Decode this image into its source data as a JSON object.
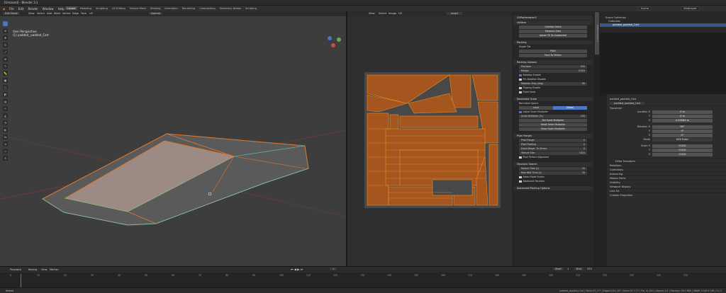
{
  "app": {
    "title": "[Unsaved] - Blender 3.1"
  },
  "menu": [
    "File",
    "Edit",
    "Render",
    "Window",
    "Help"
  ],
  "workspace_tabs": [
    "Layout",
    "Modeling",
    "Sculpting",
    "UV Editing",
    "Texture Paint",
    "Shading",
    "Animation",
    "Rendering",
    "Compositing",
    "Geometry Nodes",
    "Scripting"
  ],
  "active_tab": "Layout",
  "scene": {
    "name": "Scene",
    "view_layer": "ViewLayer"
  },
  "viewport": {
    "mode": "Edit Mode",
    "header_items": [
      "View",
      "Select",
      "Add",
      "Mesh",
      "Vertex",
      "Edge",
      "Face",
      "UV"
    ],
    "orientation": "Normal",
    "info1": "User Perspective",
    "info2": "(1) padded_ padded_Cart"
  },
  "uv_editor": {
    "header_items": [
      "View",
      "Select",
      "Image",
      "UV"
    ],
    "image": "map1"
  },
  "uvpackmaster": {
    "tab": "UVPackmaster3",
    "sections": {
      "utilities": "Utilities",
      "packing": "Packing",
      "packing_options": "Packing Options",
      "normalize_scale": "Normalize Scale",
      "pixel_margin": "Pixel Margin",
      "heuristic": "Heuristic Search",
      "advanced": "Advanced Packing Options"
    },
    "utility_buttons": [
      "Overlap Check",
      "Measure Area",
      "Adjust TD To Unselected"
    ],
    "packing_rows": {
      "mode": "Single Tile"
    },
    "pack_buttons": [
      "Pack",
      "Pack To Others"
    ],
    "options_fields": {
      "precision": "Precision",
      "precision_val": "500",
      "margin": "Margin",
      "margin_val": "0.003"
    },
    "options_checks": [
      "Rotation Enable",
      "Pre-Rotation Disable",
      "Flipping Enable",
      "Fixed Scale"
    ],
    "rotation_step": {
      "label": "Rotation Step (deg)",
      "val": "90"
    },
    "normalize": {
      "space_label": "Normalize Space:",
      "space_opts": [
        "Local",
        "Global"
      ],
      "check": "Adjust Scale Multiplier",
      "scale_mult": "Scale Multiplier (%)",
      "scale_val": "100",
      "set_btn": "Set Scale Multiplier",
      "btns": [
        "Reset Scale Multiplier",
        "Show Scale Multiplier"
      ]
    },
    "pixel": {
      "rows": [
        "Pixel Margin",
        "Pixel Padding",
        "Extra Margin To Others",
        "Texture Size"
      ],
      "vals": [
        "0",
        "0",
        "0",
        "1024"
      ],
      "tex_size_label": "1024",
      "check": "Pixel Perfect Alignment"
    },
    "heuristic_rows": [
      "Search Time (s)",
      "Max Wait Time (s)"
    ],
    "heuristic_vals": [
      "10",
      "10"
    ],
    "heuristic_checks": [
      "Allow Mixed Scales",
      "Advanced Heuristic"
    ]
  },
  "outliner": {
    "items": [
      "Scene Collection",
      "Collection",
      "padded_padded_Cart"
    ]
  },
  "properties": {
    "object": "padded_padded_Cart",
    "data": "padded_padded_Cart",
    "transform_title": "Transform",
    "rows": [
      {
        "label": "Location X",
        "val": "0 m"
      },
      {
        "label": "Y",
        "val": "0 m"
      },
      {
        "label": "Z",
        "val": "0.55589 m"
      },
      {
        "label": "Rotation X",
        "val": "90°"
      },
      {
        "label": "Y",
        "val": "0°"
      },
      {
        "label": "Z",
        "val": "0°"
      },
      {
        "label": "Mode",
        "val": "XYZ Euler"
      },
      {
        "label": "Scale X",
        "val": "0.010"
      },
      {
        "label": "Y",
        "val": "0.010"
      },
      {
        "label": "Z",
        "val": "0.010"
      }
    ],
    "collapsed": [
      "Delta Transform",
      "Relations",
      "Collections",
      "Instancing",
      "Motion Paths",
      "Visibility",
      "Viewport Display",
      "Line Art",
      "Custom Properties"
    ]
  },
  "timeline": {
    "menu": [
      "Playback",
      "Keying",
      "View",
      "Marker"
    ],
    "current": "1",
    "start": "Start",
    "start_val": "1",
    "end": "End",
    "end_val": "250",
    "ticks": [
      "0",
      "10",
      "20",
      "30",
      "40",
      "50",
      "60",
      "70",
      "80",
      "90",
      "100",
      "110",
      "120",
      "130",
      "140",
      "150",
      "160",
      "170",
      "180",
      "190",
      "200",
      "210",
      "220",
      "230",
      "240",
      "250"
    ]
  },
  "status": {
    "left": "Select",
    "right": "padded_padded_Cart | Verts 0/7,177 | Edges 0/14,297 | Faces 0/7,177 | Tris 14,150 | Objects 1/1 | Memory: 49.1 MiB | VRAM: 0.5/6.0 GiB | 3.1.2"
  }
}
